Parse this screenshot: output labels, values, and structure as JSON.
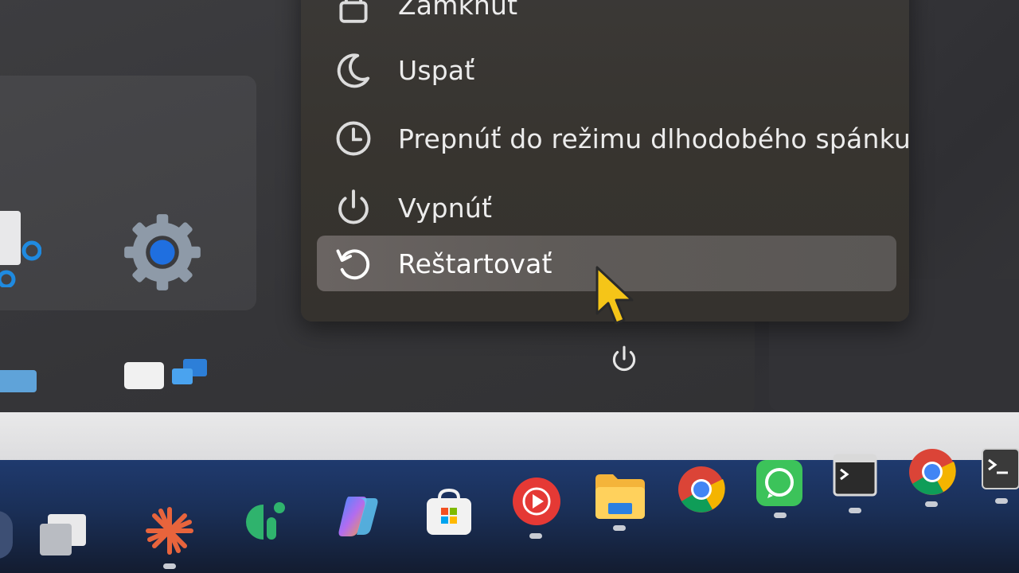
{
  "power_menu": {
    "items": [
      {
        "label": "Zamknúť",
        "icon": "lock-icon"
      },
      {
        "label": "Uspať",
        "icon": "moon-icon"
      },
      {
        "label": "Prepnúť do režimu dlhodobého spánku",
        "icon": "clock-icon"
      },
      {
        "label": "Vypnúť",
        "icon": "power-icon"
      },
      {
        "label": "Reštartovať",
        "icon": "restart-icon",
        "highlighted": true
      }
    ]
  },
  "start_menu": {
    "pinned_apps": [
      "control-panel-icon",
      "settings-icon",
      "store-app-icon",
      "remote-desktop-icon",
      "display-app-icon"
    ],
    "power_button_icon": "power-icon"
  },
  "taskbar": {
    "items": [
      "task-view-icon",
      "claude-icon",
      "app-green-icon",
      "copilot-icon",
      "microsoft-store-icon",
      "youtube-music-icon",
      "file-explorer-icon",
      "chrome-icon",
      "whatsapp-icon",
      "command-prompt-icon",
      "chrome-profile-icon",
      "terminal-icon"
    ]
  },
  "colors": {
    "menu_background": "#37342f",
    "highlight": "#605b58",
    "accent_blue": "#1f6fe0",
    "cursor_yellow": "#f5c518"
  }
}
